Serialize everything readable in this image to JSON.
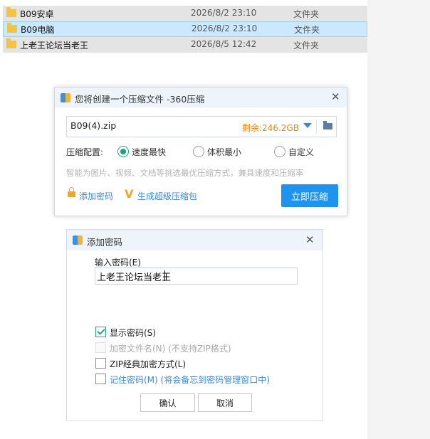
{
  "explorer": {
    "rows": [
      {
        "name": "B09安卓",
        "date": "2026/8/2 23:10",
        "type": "文件夹"
      },
      {
        "name": "B09电脑",
        "date": "2026/8/2 23:10",
        "type": "文件夹"
      },
      {
        "name": "上老王论坛当老王",
        "date": "2026/8/5 12:42",
        "type": "文件夹"
      }
    ]
  },
  "compress_dialog": {
    "title": "您将创建一个压缩文件 -360压缩",
    "filename": "B09(4).zip",
    "free_space": "剩余:246.2GB",
    "config_label": "压缩配置:",
    "options": [
      "速度最快",
      "体积最小",
      "自定义"
    ],
    "selected_option": "速度最快",
    "hint": "智能为图片、视频、文档等挑选最优压缩方式，兼具速度和压缩率",
    "add_password": "添加密码",
    "super_package": "生成超级压缩包",
    "compress_button": "立即压缩"
  },
  "password_dialog": {
    "title": "添加密码",
    "input_label": "输入密码(E)",
    "password_value": "上老王论坛当老王",
    "show_password": {
      "label": "显示密码(S)",
      "checked": true
    },
    "encrypt_filename": {
      "label": "加密文件名(N)",
      "note": "(不支持ZIP格式)",
      "disabled": true
    },
    "zip_classic": {
      "label": "ZIP经典加密方式(L)",
      "checked": false
    },
    "remember": {
      "label": "记住密码(M)",
      "note": "(将会备忘到密码管理窗口中)",
      "checked": false
    },
    "ok_button": "确认",
    "cancel_button": "取消"
  },
  "colors": {
    "accent": "#1e93ef",
    "link": "#3b87d8",
    "free_space": "#e8870b",
    "check_green": "#2aa57e",
    "selection": "#cce8ff"
  }
}
